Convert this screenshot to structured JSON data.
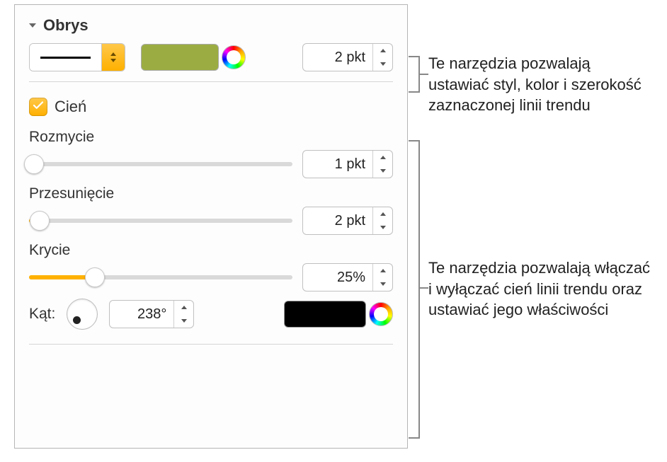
{
  "stroke": {
    "section_title": "Obrys",
    "color": "#9bad42",
    "width_value": "2 pkt"
  },
  "shadow": {
    "checkbox_label": "Cień",
    "checked": true,
    "blur": {
      "label": "Rozmycie",
      "value": "1 pkt",
      "fill_pct": 2
    },
    "offset": {
      "label": "Przesunięcie",
      "value": "2 pkt",
      "fill_pct": 4
    },
    "opacity": {
      "label": "Krycie",
      "value": "25%",
      "fill_pct": 25
    },
    "angle": {
      "label": "Kąt:",
      "value": "238°"
    },
    "color": "#000000"
  },
  "callouts": {
    "stroke_text": "Te narzędzia pozwalają ustawiać styl, kolor i szerokość zaznaczonej linii trendu",
    "shadow_text": "Te narzędzia pozwalają włączać i wyłączać cień linii trendu oraz ustawiać jego właściwości"
  }
}
